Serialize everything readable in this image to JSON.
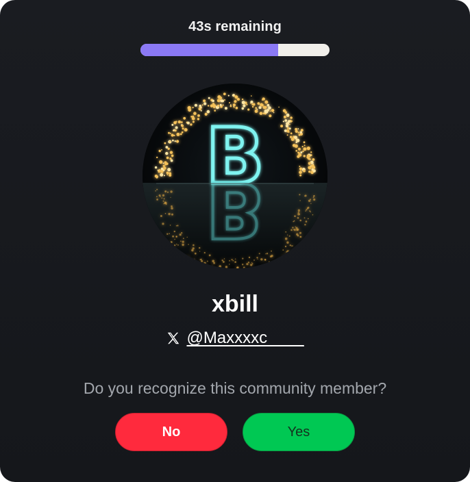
{
  "timer": {
    "remaining_text": "43s remaining",
    "progress_fraction": 0.73,
    "fill_color": "#8b79f4",
    "track_color": "#f1efea"
  },
  "profile": {
    "avatar_letter": "B",
    "display_name": "xbill",
    "platform_icon": "x-logo-icon",
    "handle": "@Maxxxxc____"
  },
  "prompt": {
    "question": "Do you recognize this community member?"
  },
  "actions": {
    "no_label": "No",
    "yes_label": "Yes",
    "no_color": "#ff2a3d",
    "yes_color": "#00c853"
  }
}
